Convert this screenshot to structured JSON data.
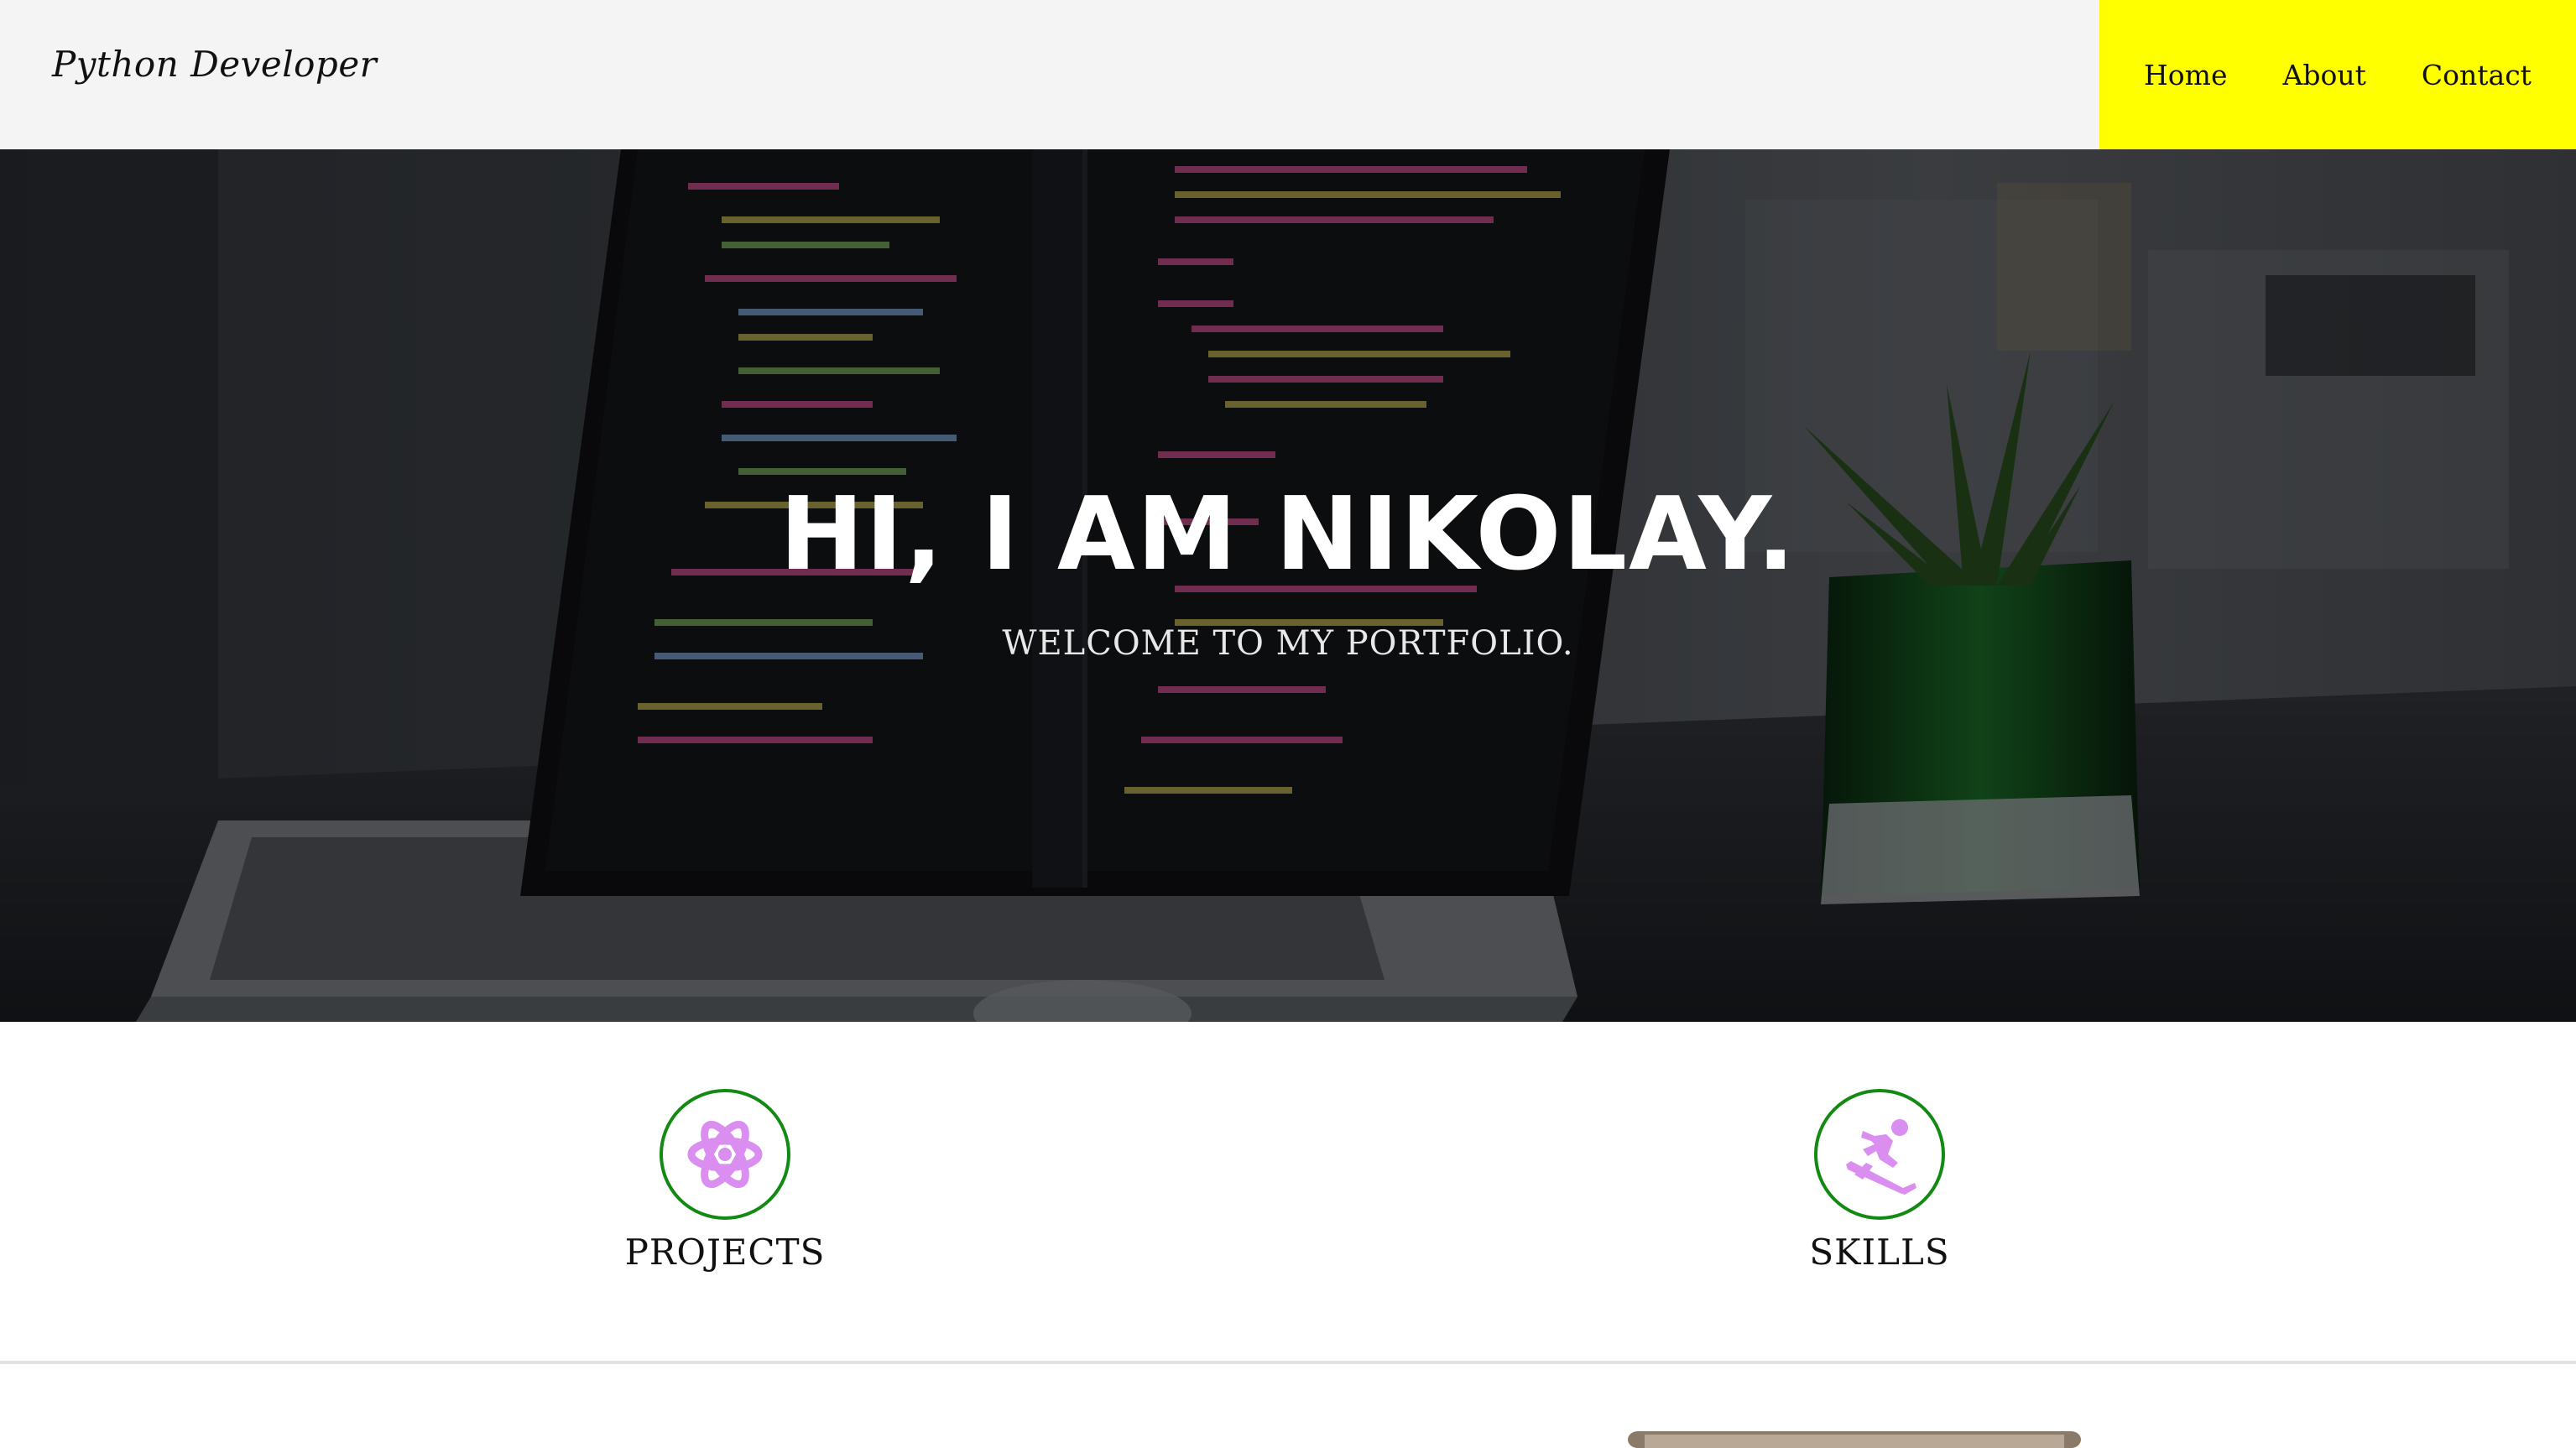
{
  "header": {
    "brand": "Python Developer",
    "nav": [
      "Home",
      "About",
      "Contact"
    ],
    "nav_bg_color": "#ffff00",
    "bar_bg_color": "#f4f4f4"
  },
  "hero": {
    "title": "HI, I AM NIKOLAY.",
    "subtitle": "WELCOME TO MY PORTFOLIO."
  },
  "features": [
    {
      "label": "PROJECTS",
      "icon": "atom-icon"
    },
    {
      "label": "SKILLS",
      "icon": "skiing-icon"
    }
  ],
  "colors": {
    "icon_ring": "#138a13",
    "icon_fill": "#d98ef0"
  }
}
